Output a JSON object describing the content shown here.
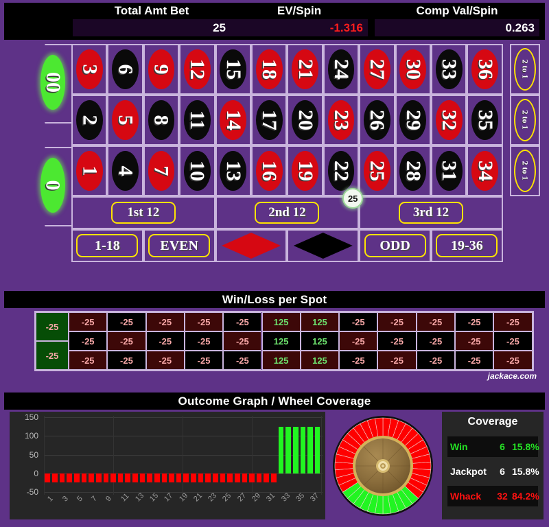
{
  "header": {
    "stats": [
      {
        "label": "Total Amt Bet",
        "value": "25",
        "negative": false
      },
      {
        "label": "EV/Spin",
        "value": "-1.316",
        "negative": true
      },
      {
        "label": "Comp Val/Spin",
        "value": "0.263",
        "negative": false
      }
    ]
  },
  "board": {
    "zeros": [
      {
        "label": "00",
        "color": "green"
      },
      {
        "label": "0",
        "color": "green"
      }
    ],
    "rows": [
      [
        {
          "n": "3",
          "c": "red"
        },
        {
          "n": "6",
          "c": "black"
        },
        {
          "n": "9",
          "c": "red"
        },
        {
          "n": "12",
          "c": "red"
        },
        {
          "n": "15",
          "c": "black"
        },
        {
          "n": "18",
          "c": "red"
        },
        {
          "n": "21",
          "c": "red"
        },
        {
          "n": "24",
          "c": "black"
        },
        {
          "n": "27",
          "c": "red"
        },
        {
          "n": "30",
          "c": "red"
        },
        {
          "n": "33",
          "c": "black"
        },
        {
          "n": "36",
          "c": "red"
        }
      ],
      [
        {
          "n": "2",
          "c": "black"
        },
        {
          "n": "5",
          "c": "red"
        },
        {
          "n": "8",
          "c": "black"
        },
        {
          "n": "11",
          "c": "black"
        },
        {
          "n": "14",
          "c": "red"
        },
        {
          "n": "17",
          "c": "black"
        },
        {
          "n": "20",
          "c": "black"
        },
        {
          "n": "23",
          "c": "red"
        },
        {
          "n": "26",
          "c": "black"
        },
        {
          "n": "29",
          "c": "black"
        },
        {
          "n": "32",
          "c": "red"
        },
        {
          "n": "35",
          "c": "black"
        }
      ],
      [
        {
          "n": "1",
          "c": "red"
        },
        {
          "n": "4",
          "c": "black"
        },
        {
          "n": "7",
          "c": "red"
        },
        {
          "n": "10",
          "c": "black"
        },
        {
          "n": "13",
          "c": "black"
        },
        {
          "n": "16",
          "c": "red"
        },
        {
          "n": "19",
          "c": "red"
        },
        {
          "n": "22",
          "c": "black"
        },
        {
          "n": "25",
          "c": "red"
        },
        {
          "n": "28",
          "c": "black"
        },
        {
          "n": "31",
          "c": "black"
        },
        {
          "n": "34",
          "c": "red"
        }
      ]
    ],
    "column_bets": [
      "2 to 1",
      "2 to 1",
      "2 to 1"
    ],
    "dozens": [
      "1st 12",
      "2nd 12",
      "3rd 12"
    ],
    "outside": [
      {
        "label": "1-18",
        "kind": "pill"
      },
      {
        "label": "EVEN",
        "kind": "pill"
      },
      {
        "label": "",
        "kind": "diamond-red"
      },
      {
        "label": "",
        "kind": "diamond-black"
      },
      {
        "label": "ODD",
        "kind": "pill"
      },
      {
        "label": "19-36",
        "kind": "pill"
      }
    ],
    "chip": {
      "value": "25"
    }
  },
  "winloss": {
    "title": "Win/Loss per Spot",
    "zeros": [
      "-25",
      "-25"
    ],
    "rows": [
      [
        "-25",
        "-25",
        "-25",
        "-25",
        "-25",
        "125",
        "125",
        "-25",
        "-25",
        "-25",
        "-25",
        "-25"
      ],
      [
        "-25",
        "-25",
        "-25",
        "-25",
        "-25",
        "125",
        "125",
        "-25",
        "-25",
        "-25",
        "-25",
        "-25"
      ],
      [
        "-25",
        "-25",
        "-25",
        "-25",
        "-25",
        "125",
        "125",
        "-25",
        "-25",
        "-25",
        "-25",
        "-25"
      ]
    ],
    "watermark": "jackace.com"
  },
  "outcome": {
    "title": "Outcome Graph / Wheel Coverage",
    "coverage": {
      "title": "Coverage",
      "rows": [
        {
          "label": "Win",
          "count": "6",
          "pct": "15.8%"
        },
        {
          "label": "Jackpot",
          "count": "6",
          "pct": "15.8%"
        },
        {
          "label": "Whack",
          "count": "32",
          "pct": "84.2%"
        }
      ]
    }
  },
  "chart_data": {
    "type": "bar",
    "title": "Outcome Graph / Wheel Coverage",
    "xlabel": "",
    "ylabel": "",
    "ylim": [
      -50,
      150
    ],
    "yticks": [
      150,
      100,
      50,
      0,
      -50
    ],
    "grid": true,
    "legend": false,
    "categories": [
      "1",
      "2",
      "3",
      "4",
      "5",
      "6",
      "7",
      "8",
      "9",
      "10",
      "11",
      "12",
      "13",
      "14",
      "15",
      "16",
      "17",
      "18",
      "19",
      "20",
      "21",
      "22",
      "23",
      "24",
      "25",
      "26",
      "27",
      "28",
      "29",
      "30",
      "31",
      "32",
      "33",
      "34",
      "35",
      "36",
      "37",
      "38"
    ],
    "tick_labels": [
      "1",
      "3",
      "5",
      "7",
      "9",
      "11",
      "13",
      "15",
      "17",
      "19",
      "21",
      "23",
      "25",
      "27",
      "29",
      "31",
      "33",
      "35",
      "37"
    ],
    "values": [
      -25,
      -25,
      -25,
      -25,
      -25,
      -25,
      -25,
      -25,
      -25,
      -25,
      -25,
      -25,
      -25,
      -25,
      -25,
      -25,
      -25,
      -25,
      -25,
      -25,
      -25,
      -25,
      -25,
      -25,
      -25,
      -25,
      -25,
      -25,
      -25,
      -25,
      -25,
      -25,
      125,
      125,
      125,
      125,
      125,
      125
    ],
    "colors": {
      "loss": "#fe0000",
      "win": "#21f521"
    }
  }
}
